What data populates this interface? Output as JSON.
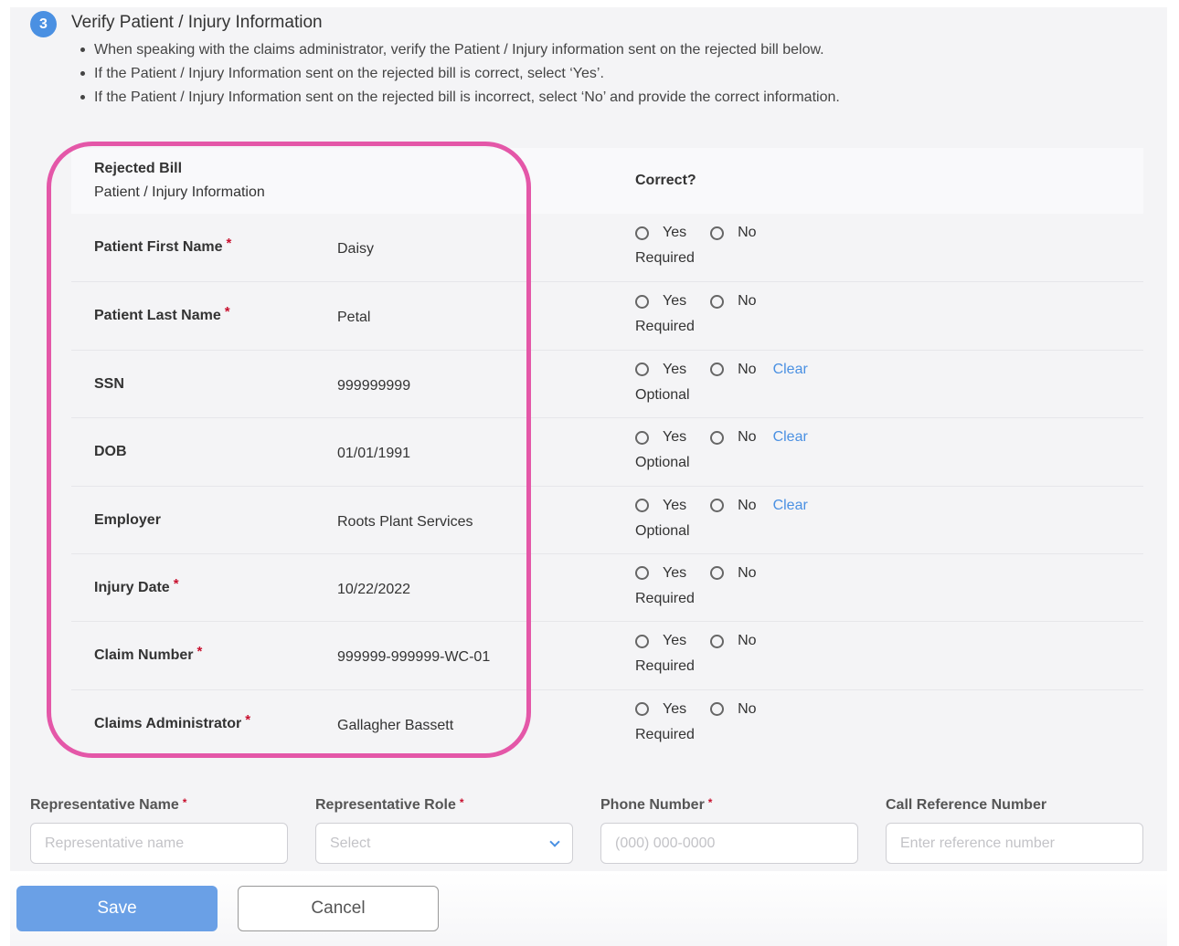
{
  "section": {
    "step_number": "3",
    "title": "Verify Patient / Injury Information",
    "instructions": [
      "When speaking with the claims administrator, verify the Patient / Injury information sent on the rejected bill below.",
      "If the Patient / Injury Information sent on the rejected bill is correct, select ‘Yes’.",
      "If the Patient / Injury Information sent on the rejected bill is incorrect, select ‘No’ and provide the correct information."
    ]
  },
  "table": {
    "header_line1": "Rejected Bill",
    "header_line2": "Patient / Injury Information",
    "header_correct": "Correct?",
    "yes_label": "Yes",
    "no_label": "No",
    "clear_label": "Clear",
    "rows": [
      {
        "label": "Patient First Name",
        "required": true,
        "value": "Daisy",
        "status": "Required",
        "clear": false
      },
      {
        "label": "Patient Last Name",
        "required": true,
        "value": "Petal",
        "status": "Required",
        "clear": false
      },
      {
        "label": "SSN",
        "required": false,
        "value": "999999999",
        "status": "Optional",
        "clear": true
      },
      {
        "label": "DOB",
        "required": false,
        "value": "01/01/1991",
        "status": "Optional",
        "clear": true
      },
      {
        "label": "Employer",
        "required": false,
        "value": "Roots Plant Services",
        "status": "Optional",
        "clear": true
      },
      {
        "label": "Injury Date",
        "required": true,
        "value": "10/22/2022",
        "status": "Required",
        "clear": false
      },
      {
        "label": "Claim Number",
        "required": true,
        "value": "999999-999999-WC-01",
        "status": "Required",
        "clear": false
      },
      {
        "label": "Claims Administrator",
        "required": true,
        "value": "Gallagher Bassett",
        "status": "Required",
        "clear": false
      }
    ]
  },
  "representative": {
    "name": {
      "label": "Representative Name",
      "placeholder": "Representative name"
    },
    "role": {
      "label": "Representative Role",
      "placeholder": "Select"
    },
    "phone": {
      "label": "Phone Number",
      "placeholder": "(000) 000-0000"
    },
    "reference": {
      "label": "Call Reference Number",
      "placeholder": "Enter reference number"
    }
  },
  "actions": {
    "save_label": "Save",
    "cancel_label": "Cancel"
  },
  "colors": {
    "accent": "#4a90e2",
    "save_button": "#6aa0e6",
    "highlight": "#e457a8",
    "required_star": "#c8102e"
  }
}
